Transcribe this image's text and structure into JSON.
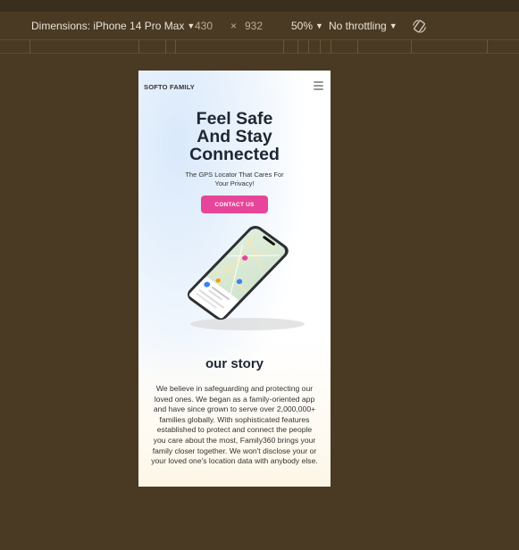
{
  "toolbar": {
    "device_label": "Dimensions: iPhone 14 Pro Max",
    "width": "430",
    "times": "×",
    "height": "932",
    "zoom": "50%",
    "throttling": "No throttling"
  },
  "site": {
    "brand": "SOFTO FAMILY",
    "hero_title_line1": "Feel Safe",
    "hero_title_line2": "And Stay",
    "hero_title_line3": "Connected",
    "hero_subtitle": "The GPS Locator That Cares For Your Privacy!",
    "cta_label": "CONTACT US",
    "story_title": "our story",
    "story_text": "We believe in safeguarding and protecting our loved ones. We began as a family-oriented app and have since grown to serve over 2,000,000+ families globally. With sophisticated features established to protect and connect the people you care about the most, Family360 brings your family closer together. We won't disclose your or your loved one's location data with anybody else."
  },
  "colors": {
    "accent": "#e7459a",
    "heading": "#1f2633",
    "devtools_bg": "#4a3a23"
  }
}
